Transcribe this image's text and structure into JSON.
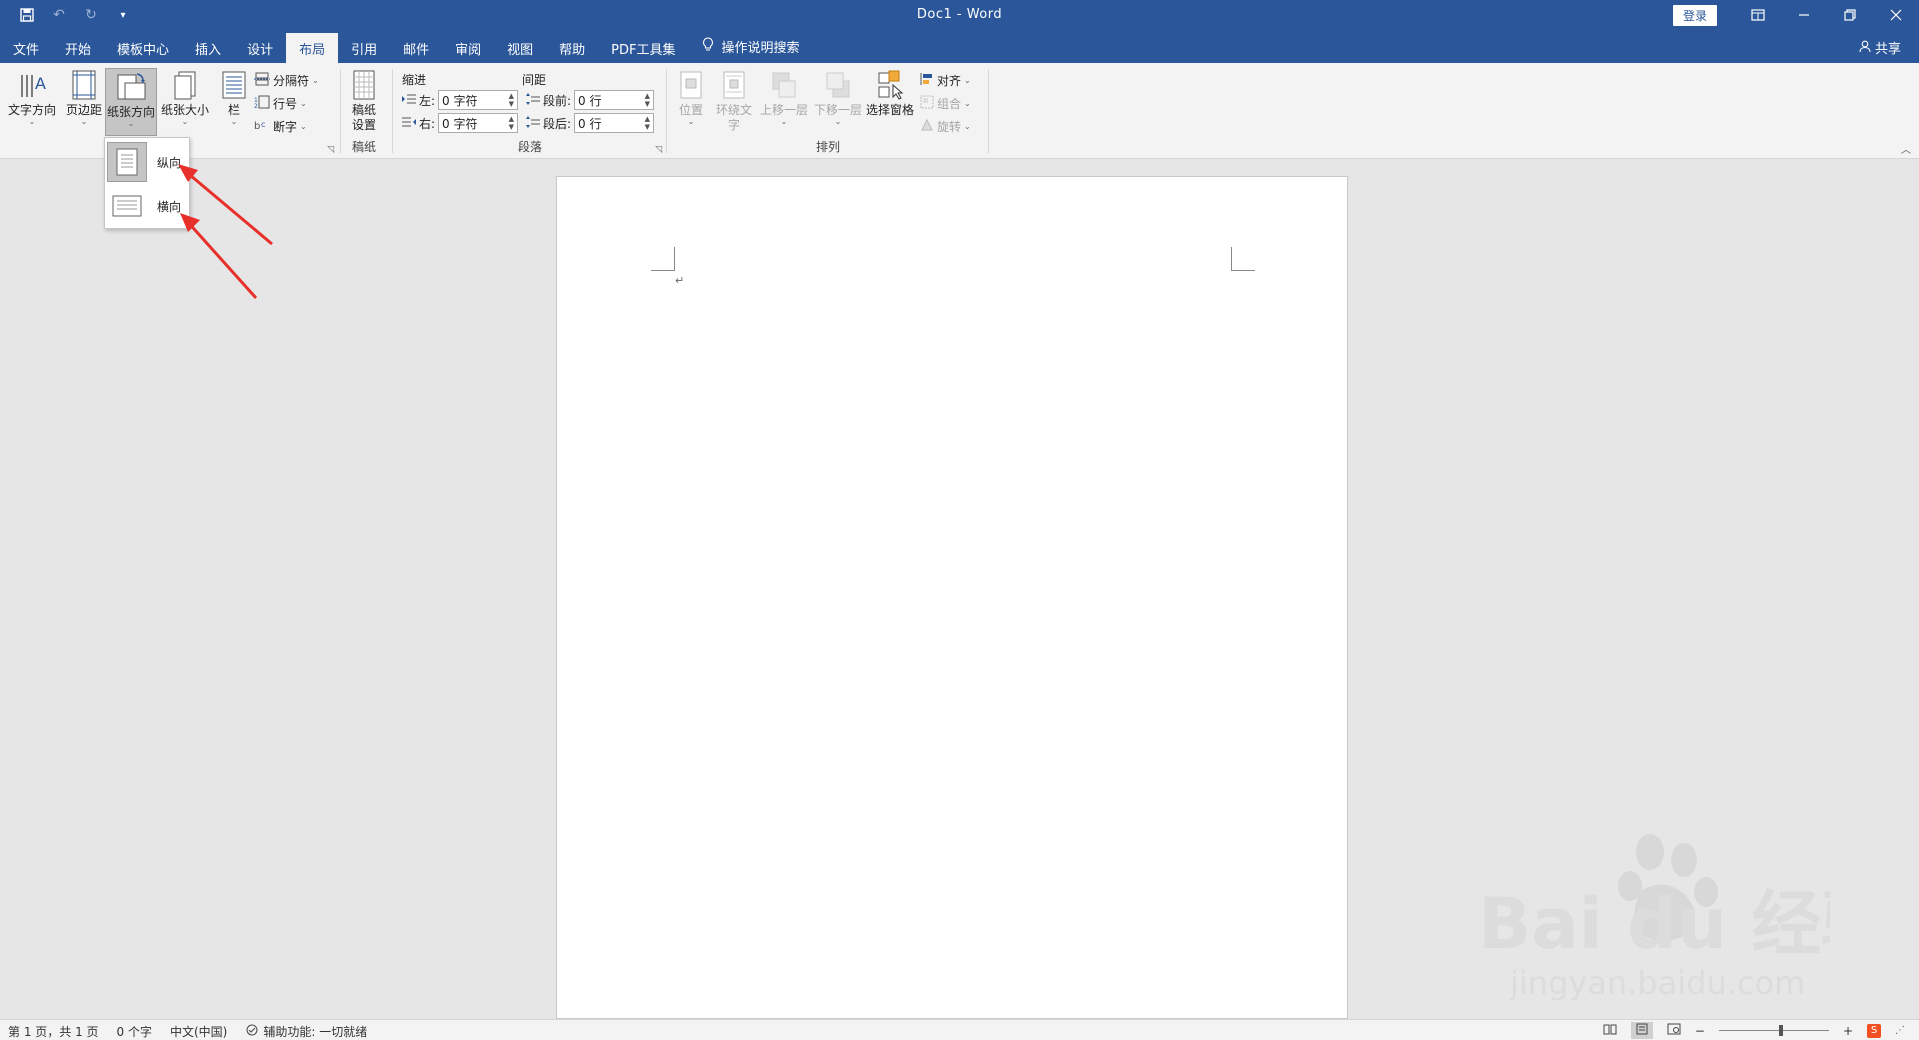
{
  "app": {
    "title": "Doc1  -  Word",
    "login_label": "登录"
  },
  "qat": {
    "icons": [
      "save-icon",
      "undo-icon",
      "redo-icon",
      "customize-icon"
    ]
  },
  "tabs": [
    {
      "label": "文件"
    },
    {
      "label": "开始"
    },
    {
      "label": "模板中心"
    },
    {
      "label": "插入"
    },
    {
      "label": "设计"
    },
    {
      "label": "布局",
      "active": true
    },
    {
      "label": "引用"
    },
    {
      "label": "邮件"
    },
    {
      "label": "审阅"
    },
    {
      "label": "视图"
    },
    {
      "label": "帮助"
    },
    {
      "label": "PDF工具集"
    }
  ],
  "tell_me": "操作说明搜索",
  "share": "共享",
  "ribbon": {
    "page_setup": {
      "text_direction": "文字方向",
      "margins": "页边距",
      "orientation": "纸张方向",
      "size": "纸张大小",
      "columns": "栏",
      "breaks": "分隔符",
      "line_numbers": "行号",
      "hyphenation": "断字"
    },
    "manuscript": {
      "settings_line1": "稿纸",
      "settings_line2": "设置",
      "group_label": "稿纸"
    },
    "paragraph": {
      "indent_label": "缩进",
      "spacing_label": "间距",
      "left_label": "左:",
      "right_label": "右:",
      "before_label": "段前:",
      "after_label": "段后:",
      "left_value": "0 字符",
      "right_value": "0 字符",
      "before_value": "0 行",
      "after_value": "0 行",
      "group_label": "段落"
    },
    "arrange": {
      "position": "位置",
      "wrap_line1": "环绕文",
      "wrap_line2": "字",
      "bring_forward": "上移一层",
      "send_backward": "下移一层",
      "selection_pane": "选择窗格",
      "align": "对齐",
      "group": "组合",
      "rotate": "旋转",
      "group_label": "排列"
    }
  },
  "orientation_menu": {
    "portrait": "纵向",
    "landscape": "横向",
    "selected": "portrait"
  },
  "document": {
    "paragraph_mark": "↵"
  },
  "statusbar": {
    "page": "第 1 页，共 1 页",
    "words": "0 个字",
    "language": "中文(中国)",
    "accessibility": "辅助功能: 一切就绪"
  },
  "watermark": {
    "brand": "Bai du 经验",
    "url": "jingyan.baidu.com"
  },
  "colors": {
    "accent": "#2b579a",
    "arrow": "#e8302a"
  }
}
